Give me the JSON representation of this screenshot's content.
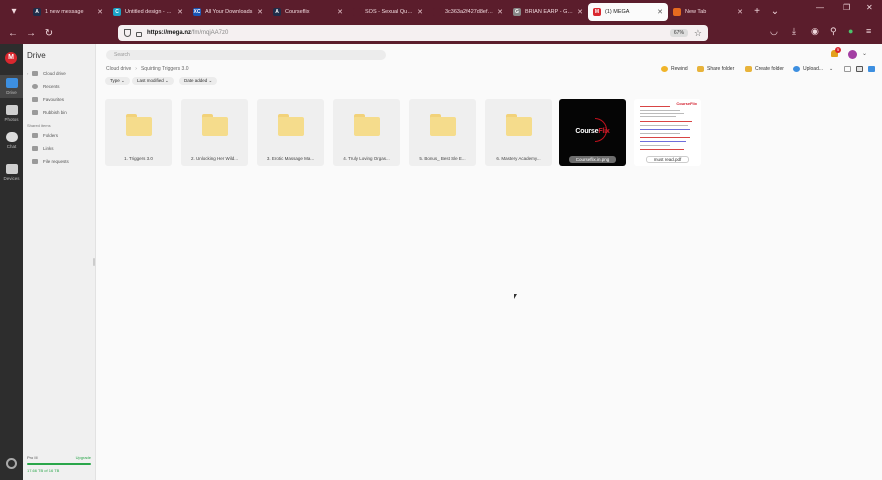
{
  "browser": {
    "tabs": [
      {
        "title": "1 new message",
        "fav_color": "#1f2d4a",
        "fav_glyph": "A"
      },
      {
        "title": "Untitled design - 120",
        "fav_color": "#1ba3c6",
        "fav_glyph": "C"
      },
      {
        "title": "All Your Downloads",
        "fav_color": "#1855b5",
        "fav_glyph": "XC"
      },
      {
        "title": "Courseflix",
        "fav_color": "#1f2d4a",
        "fav_glyph": "A"
      },
      {
        "title": "SOS - Sexual Quantum",
        "fav_color": "#5b1d2c",
        "fav_glyph": ""
      },
      {
        "title": "3c363a2f427d8ef082ee5f5",
        "fav_color": "#5b1d2c",
        "fav_glyph": ""
      },
      {
        "title": "BRIAN EARP - GENITI",
        "fav_color": "#888888",
        "fav_glyph": "G"
      },
      {
        "title": "(1) MEGA",
        "fav_color": "#d9272e",
        "fav_glyph": "M"
      },
      {
        "title": "New Tab",
        "fav_color": "#e66a1f",
        "fav_glyph": ""
      }
    ],
    "url_host": "https://mega.nz",
    "url_path": "/fm/mqjAA7z0",
    "zoom": "67%"
  },
  "rail": {
    "logo": "M",
    "items": [
      {
        "label": "Drive"
      },
      {
        "label": "Photos"
      },
      {
        "label": "Chat"
      },
      {
        "label": "Devices"
      }
    ]
  },
  "sidebar": {
    "title": "Drive",
    "items": [
      {
        "label": "Cloud drive"
      },
      {
        "label": "Recents"
      },
      {
        "label": "Favourites"
      },
      {
        "label": "Rubbish bin"
      }
    ],
    "section_label": "Shared items",
    "shared_items": [
      {
        "label": "Folders"
      },
      {
        "label": "Links"
      },
      {
        "label": "File requests"
      }
    ],
    "storage": {
      "plan": "Pro III",
      "upgrade": "Upgrade",
      "used": "17.66 TB of 16 TB",
      "fraction": 1.0
    }
  },
  "main": {
    "search_placeholder": "Search",
    "notifications_count": "5",
    "breadcrumb": [
      "Cloud drive",
      "Squirting Triggers 3.0"
    ],
    "actions": {
      "rewind": "Rewind",
      "share_folder": "Share folder",
      "create_folder": "Create folder",
      "upload": "Upload..."
    },
    "filters": [
      "Type",
      "Last modified",
      "Date added"
    ],
    "items": [
      {
        "type": "folder",
        "name": "1. Triggers 3.0"
      },
      {
        "type": "folder",
        "name": "2. Unlocking Her Wild..."
      },
      {
        "type": "folder",
        "name": "3. Erotic Massage Ma..."
      },
      {
        "type": "folder",
        "name": "4. Truly Loving Orgas..."
      },
      {
        "type": "folder",
        "name": "5. Bonus_ Best Sle E..."
      },
      {
        "type": "folder",
        "name": "6. Mastery Academy..."
      },
      {
        "type": "image",
        "name": "Courseflix.in.png",
        "brand_white": "Course",
        "brand_red": "Flix"
      },
      {
        "type": "pdf",
        "name": "must read.pdf",
        "brand": "CourseFlix"
      }
    ]
  },
  "colors": {
    "chrome": "#5b1d2c",
    "folder": "#f5dc8c",
    "mega_red": "#d9272e",
    "accent_green": "#2aa64a"
  }
}
